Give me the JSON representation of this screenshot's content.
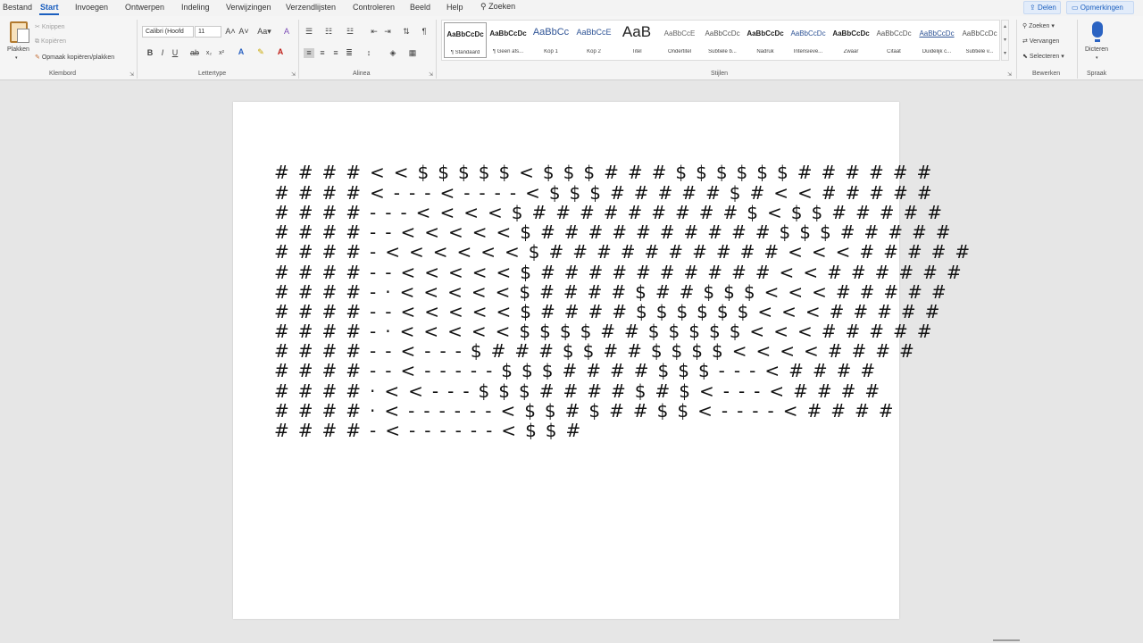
{
  "menu": {
    "items": [
      "Bestand",
      "Start",
      "Invoegen",
      "Ontwerpen",
      "Indeling",
      "Verwijzingen",
      "Verzendlijsten",
      "Controleren",
      "Beeld",
      "Help"
    ],
    "search_label": "Zoeken",
    "share_label": "Delen",
    "comments_label": "Opmerkingen"
  },
  "ribbon": {
    "clipboard": {
      "paste_label": "Plakken",
      "cut_label": "Knippen",
      "copy_label": "Kopiëren",
      "format_painter_label": "Opmaak kopiëren/plakken",
      "group_label": "Klembord"
    },
    "font": {
      "font_name": "Calibri (Hoofd",
      "font_size": "11",
      "group_label": "Lettertype"
    },
    "paragraph": {
      "group_label": "Alinea"
    },
    "styles": {
      "group_label": "Stijlen",
      "tiles": [
        {
          "sample": "AaBbCcDc",
          "label": "¶ Standaard"
        },
        {
          "sample": "AaBbCcDc",
          "label": "¶ Geen afs..."
        },
        {
          "sample": "AaBbCc",
          "label": "Kop 1"
        },
        {
          "sample": "AaBbCcE",
          "label": "Kop 2"
        },
        {
          "sample": "AaB",
          "label": "Titel"
        },
        {
          "sample": "AaBbCcE",
          "label": "Ondertitel"
        },
        {
          "sample": "AaBbCcDc",
          "label": "Subtiele b..."
        },
        {
          "sample": "AaBbCcDc",
          "label": "Nadruk"
        },
        {
          "sample": "AaBbCcDc",
          "label": "Intensieve..."
        },
        {
          "sample": "AaBbCcDc",
          "label": "Zwaar"
        },
        {
          "sample": "AaBbCcDc",
          "label": "Citaat"
        },
        {
          "sample": "AaBbCcDc",
          "label": "Duidelijk c..."
        },
        {
          "sample": "AaBbCcDc",
          "label": "Subtiele v..."
        }
      ]
    },
    "editing": {
      "find_label": "Zoeken",
      "replace_label": "Vervangen",
      "select_label": "Selecteren",
      "group_label": "Bewerken"
    },
    "voice": {
      "dictate_label": "Dicteren",
      "group_label": "Spraak"
    }
  },
  "document": {
    "lines": [
      "####<<$$$$$<$$$###$$$$$$######",
      "####<---<----<$$$#####$#<<#####",
      "####---<<<<$#########$<$$#####",
      "####--<<<<<$##########$$$#####",
      "####-<<<<<<$##########<<<#####",
      "####--<<<<<$##########<<######",
      "####-·<<<<<$####$##$$$<<<#####",
      "####--<<<<<$####$$$$$$<<<#####",
      "####-·<<<<<$$$$##$$$$$<<<#####",
      "####--<---$###$$##$$$$<<<<####",
      "####--<-----$$$####$$$---<####",
      "####·<<---$$$####$#$<---<####",
      "####·<------<$$#$##$$<----<####",
      "####-<------<$$#"
    ]
  }
}
